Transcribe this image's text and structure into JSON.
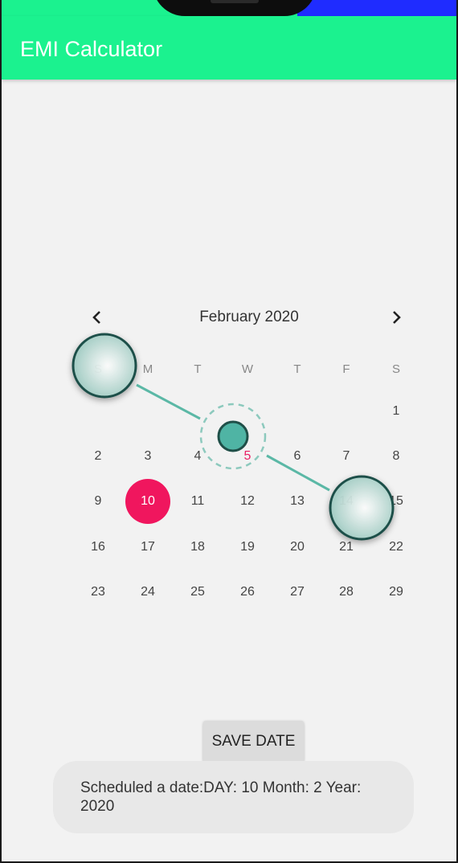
{
  "app": {
    "title": "EMI Calculator"
  },
  "calendar": {
    "month_label": "February 2020",
    "weekdays": [
      "S",
      "M",
      "T",
      "W",
      "T",
      "F",
      "S"
    ],
    "weeks": [
      [
        "",
        "",
        "",
        "",
        "",
        "",
        "1"
      ],
      [
        "2",
        "3",
        "4",
        "5",
        "6",
        "7",
        "8"
      ],
      [
        "9",
        "10",
        "11",
        "12",
        "13",
        "14",
        "15"
      ],
      [
        "16",
        "17",
        "18",
        "19",
        "20",
        "21",
        "22"
      ],
      [
        "23",
        "24",
        "25",
        "26",
        "27",
        "28",
        "29"
      ]
    ],
    "selected_day": "10",
    "today": "5",
    "colors": {
      "selected": "#f0165e",
      "today": "#e91e63",
      "appbar": "#1bf28f",
      "touch": "#4fb4a4"
    },
    "icons": {
      "prev": "chevron-left-icon",
      "next": "chevron-right-icon"
    }
  },
  "actions": {
    "save_label": "SAVE DATE"
  },
  "toast": {
    "message": "Scheduled a date:DAY: 10  Month: 2   Year: 2020"
  }
}
